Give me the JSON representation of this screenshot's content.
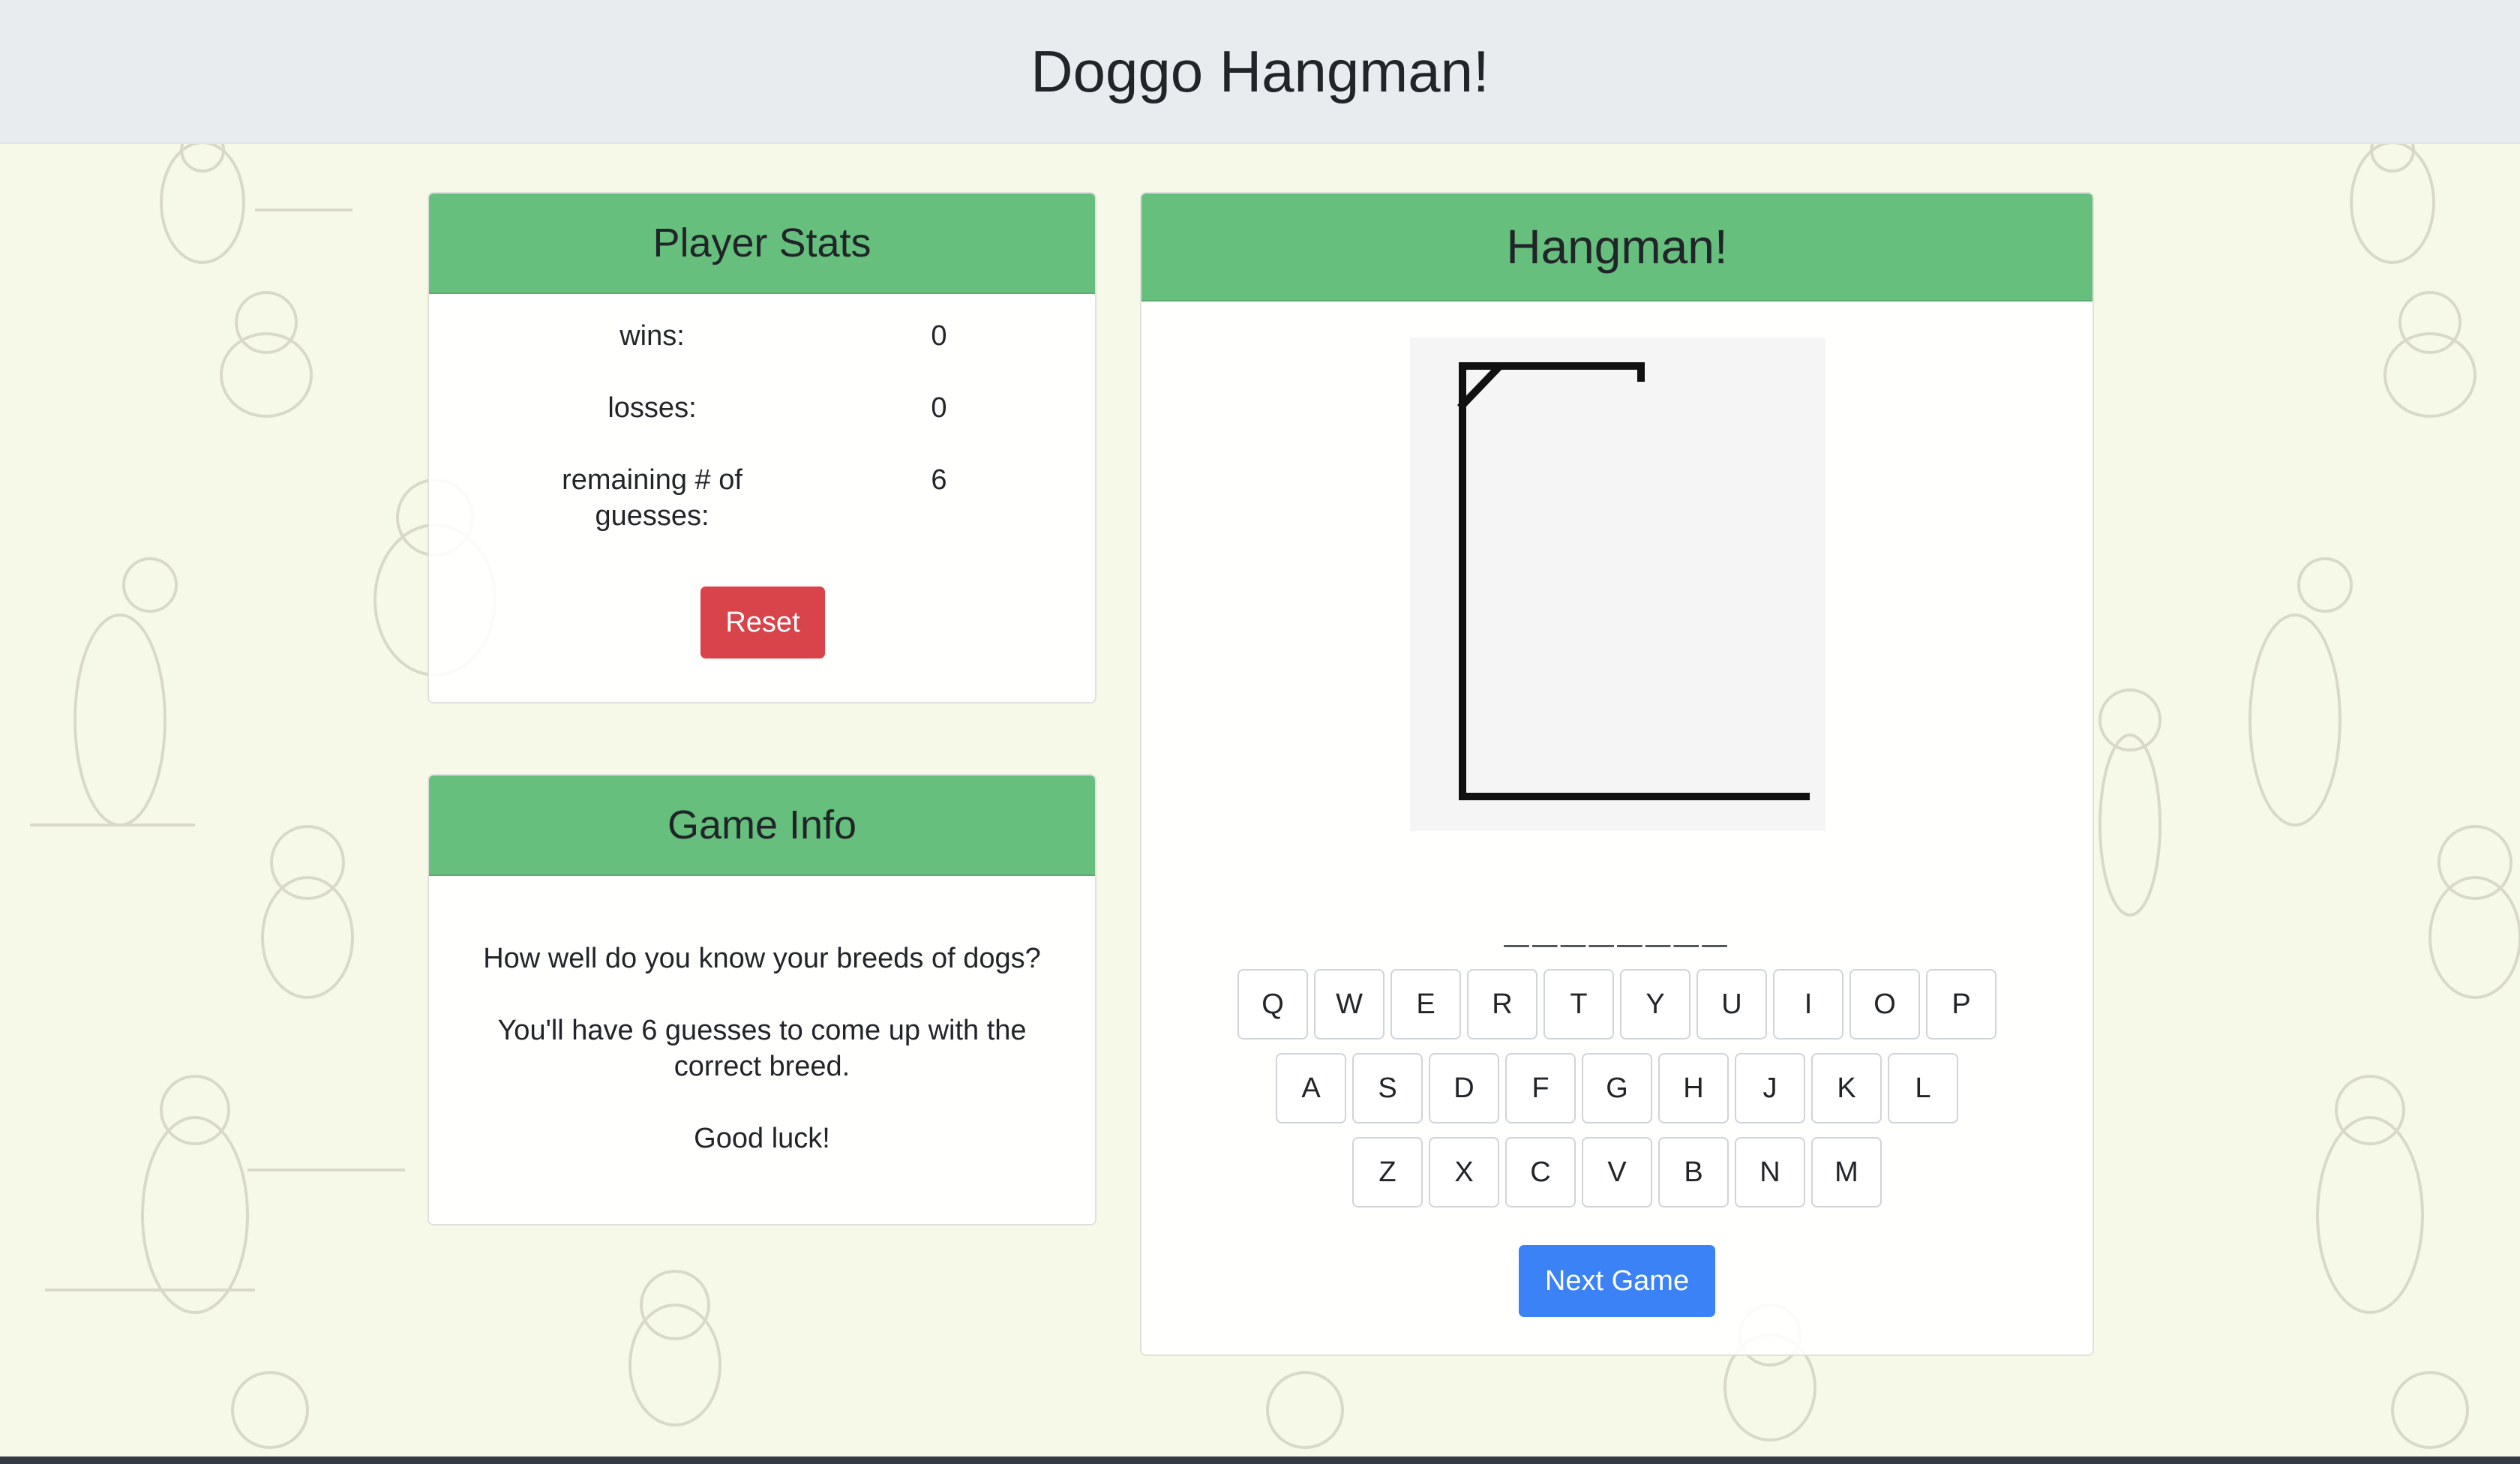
{
  "header": {
    "title": "Doggo Hangman!"
  },
  "player_stats": {
    "title": "Player Stats",
    "wins_label": "wins:",
    "wins_value": "0",
    "losses_label": "losses:",
    "losses_value": "0",
    "remaining_label_line1": "remaining # of",
    "remaining_label_line2": "guesses:",
    "remaining_value": "6",
    "reset_label": "Reset"
  },
  "game_info": {
    "title": "Game Info",
    "line1": "How well do you know your breeds of dogs?",
    "line2a": "You'll have 6 guesses to come up with the",
    "line2b": "correct breed.",
    "line3": "Good luck!"
  },
  "hangman": {
    "title": "Hangman!",
    "word_display": "________",
    "keyboard": {
      "row1": [
        "Q",
        "W",
        "E",
        "R",
        "T",
        "Y",
        "U",
        "I",
        "O",
        "P"
      ],
      "row2": [
        "A",
        "S",
        "D",
        "F",
        "G",
        "H",
        "J",
        "K",
        "L"
      ],
      "row3": [
        "Z",
        "X",
        "C",
        "V",
        "B",
        "N",
        "M"
      ]
    },
    "next_label": "Next Game"
  },
  "colors": {
    "card_header": "#66bf7c",
    "reset_button": "#d9434a",
    "next_button": "#3b82f6",
    "background": "#f7f9e8"
  }
}
